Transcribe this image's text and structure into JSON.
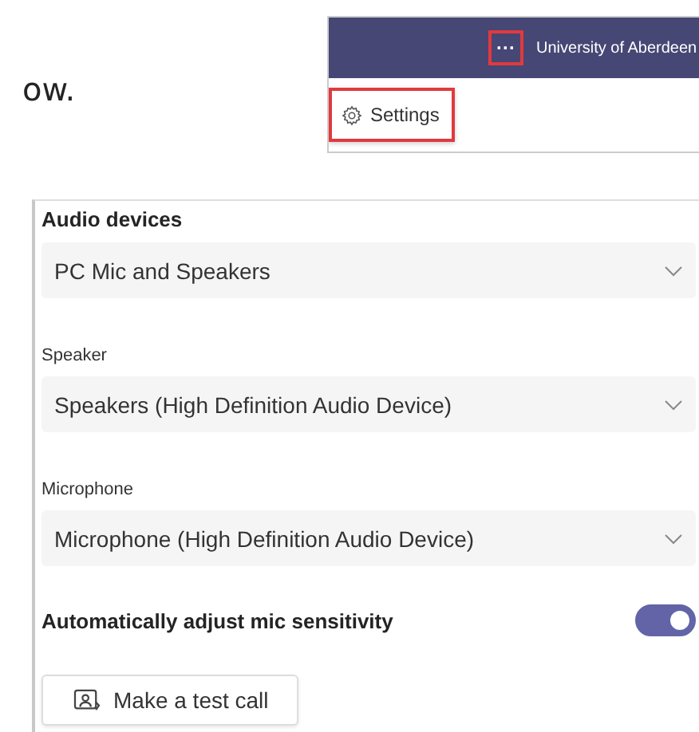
{
  "intro_text": "ow.",
  "menu_snippet": {
    "more_button": {
      "label": "···",
      "highlighted": true
    },
    "account_name": "University of Aberdeen",
    "settings_item": {
      "label": "Settings",
      "highlighted": true
    }
  },
  "audio_panel": {
    "heading": "Audio devices",
    "dropdowns": [
      {
        "value": "PC Mic and Speakers"
      },
      {
        "label": "Speaker",
        "value": "Speakers (High Definition Audio Device)"
      },
      {
        "label": "Microphone",
        "value": "Microphone (High Definition Audio Device)"
      }
    ],
    "toggle": {
      "label": "Automatically adjust mic sensitivity",
      "on": true
    },
    "test_call_button": "Make a test call"
  }
}
